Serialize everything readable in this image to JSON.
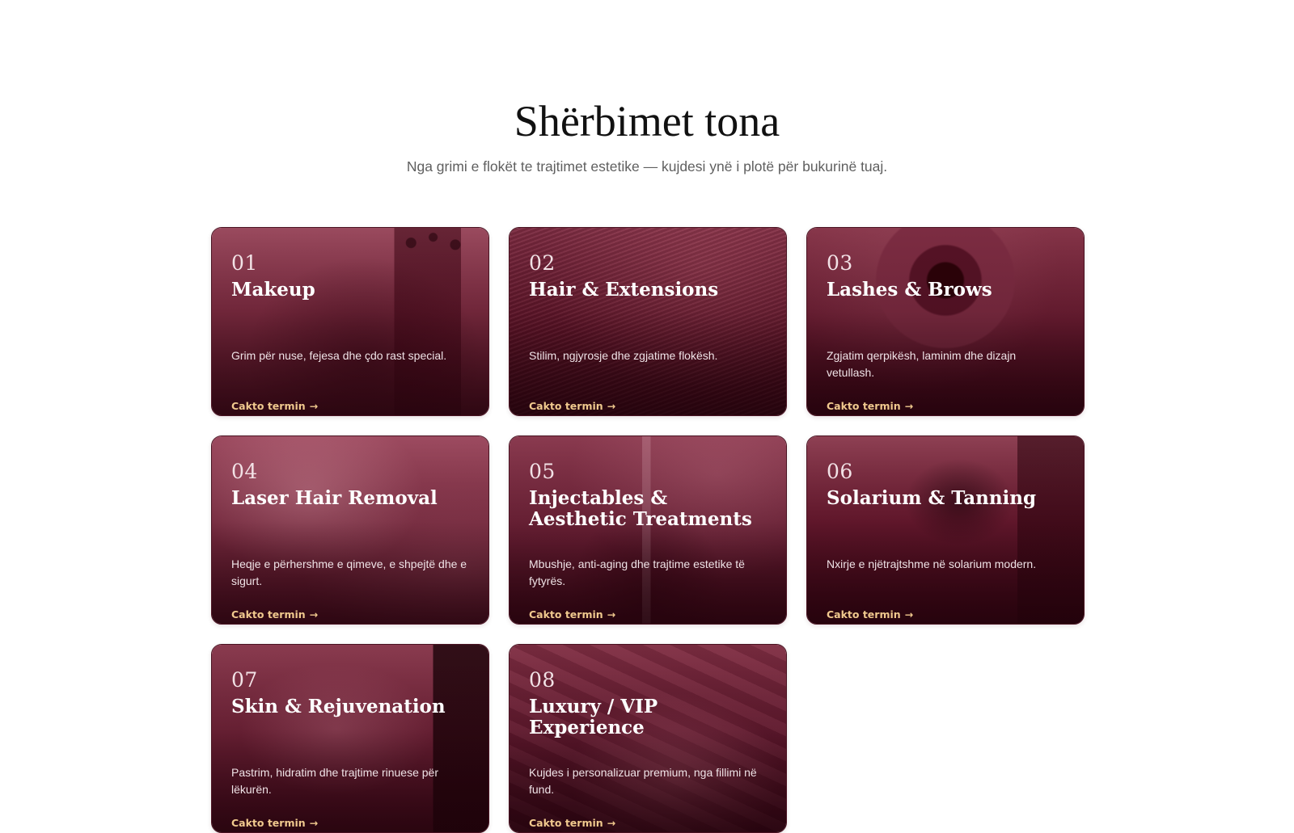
{
  "section": {
    "heading": "Shërbimet tona",
    "subtitle": "Nga grimi e flokët te trajtimet estetike — kujdesi ynë i plotë për bukurinë tuaj."
  },
  "cards": [
    {
      "number": "01",
      "title": "Makeup",
      "description": "Grim për nuse, fejesa dhe çdo rast special.",
      "cta": "Cakto termin",
      "arrow": "→"
    },
    {
      "number": "02",
      "title": "Hair & Extensions",
      "description": "Stilim, ngjyrosje dhe zgjatime flokësh.",
      "cta": "Cakto termin",
      "arrow": "→"
    },
    {
      "number": "03",
      "title": "Lashes & Brows",
      "description": "Zgjatim qerpikësh, laminim dhe dizajn vetullash.",
      "cta": "Cakto termin",
      "arrow": "→"
    },
    {
      "number": "04",
      "title": "Laser Hair Removal",
      "description": "Heqje e përhershme e qimeve, e shpejtë dhe e sigurt.",
      "cta": "Cakto termin",
      "arrow": "→"
    },
    {
      "number": "05",
      "title": "Injectables & Aesthetic Treatments",
      "description": "Mbushje, anti-aging dhe trajtime estetike të fytyrës.",
      "cta": "Cakto termin",
      "arrow": "→"
    },
    {
      "number": "06",
      "title": "Solarium & Tanning",
      "description": "Nxirje e njëtrajtshme në solarium modern.",
      "cta": "Cakto termin",
      "arrow": "→"
    },
    {
      "number": "07",
      "title": "Skin & Rejuvenation",
      "description": "Pastrim, hidratim dhe trajtime rinuese për lëkurën.",
      "cta": "Cakto termin",
      "arrow": "→"
    },
    {
      "number": "08",
      "title": "Luxury / VIP Experience",
      "description": "Kujdes i personalizuar premium, nga fillimi në fund.",
      "cta": "Cakto termin",
      "arrow": "→"
    }
  ],
  "colors": {
    "card_tint": "#7a2a40",
    "cta_accent": "#f0c98e",
    "heading_text": "#111111",
    "subtitle_text": "#5f5f5f"
  }
}
